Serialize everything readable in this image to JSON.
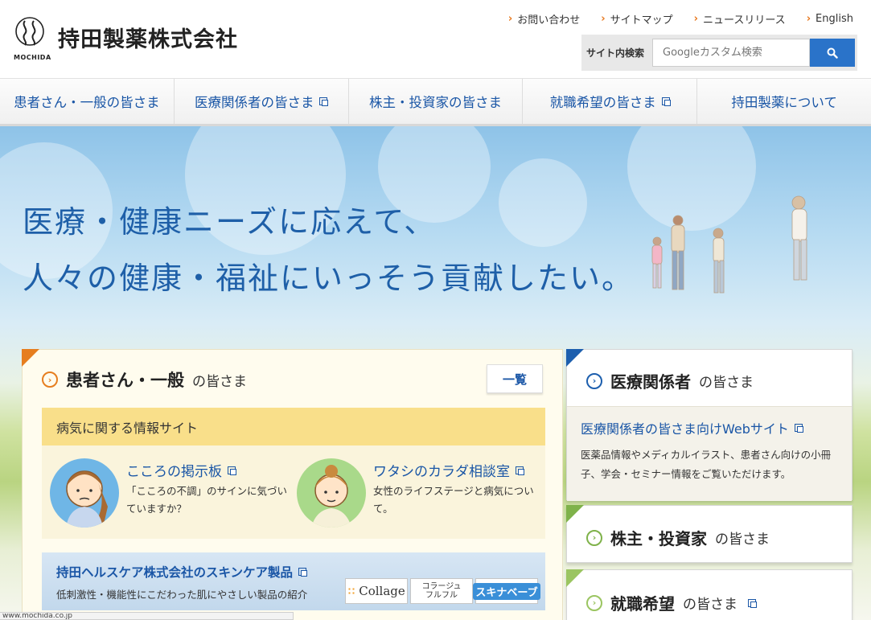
{
  "header": {
    "logo_sub": "MOCHIDA",
    "company_name": "持田製薬株式会社",
    "util_links": [
      "お問い合わせ",
      "サイトマップ",
      "ニュースリリース",
      "English"
    ],
    "search": {
      "label": "サイト内検索",
      "placeholder": "Googleカスタム検索"
    }
  },
  "nav": [
    {
      "label": "患者さん・一般の皆さま",
      "external": false
    },
    {
      "label": "医療関係者の皆さま",
      "external": true
    },
    {
      "label": "株主・投資家の皆さま",
      "external": false
    },
    {
      "label": "就職希望の皆さま",
      "external": true
    },
    {
      "label": "持田製薬について",
      "external": false
    }
  ],
  "hero": {
    "line1": "医療・健康ニーズに応えて、",
    "line2": "人々の健康・福祉にいっそう貢献したい。"
  },
  "patients_panel": {
    "title_strong": "患者さん・一般",
    "title_weak": "の皆さま",
    "list_button": "一覧",
    "info_header": "病気に関する情報サイト",
    "cards": [
      {
        "link": "こころの掲示板",
        "desc": "「こころの不調」のサインに気づいていますか？"
      },
      {
        "link": "ワタシのカラダ相談室",
        "desc": "女性のライフステージと病気について。"
      }
    ],
    "skincare": {
      "title": "持田ヘルスケア株式会社のスキンケア製品",
      "desc": "低刺激性・機能性にこだわった肌にやさしい製品の紹介",
      "brands": [
        "Collage",
        "コラージュ フルフル",
        "スキナベーブ"
      ]
    }
  },
  "medical_panel": {
    "title_strong": "医療関係者",
    "title_weak": "の皆さま",
    "link": "医療関係者の皆さま向けWebサイト",
    "desc": "医薬品情報やメディカルイラスト、患者さん向けの小冊子、学会・セミナー情報をご覧いただけます。"
  },
  "investor_panel": {
    "title_strong": "株主・投資家",
    "title_weak": "の皆さま"
  },
  "career_panel": {
    "title_strong": "就職希望",
    "title_weak": "の皆さま"
  },
  "status_bar": {
    "url": "www.mochida.co.jp"
  },
  "colors": {
    "brand_blue": "#1a56a6",
    "accent_orange": "#e67e1f",
    "medical_blue": "#1d5fae",
    "investor_green": "#7fb24a",
    "career_green": "#9bc561"
  }
}
